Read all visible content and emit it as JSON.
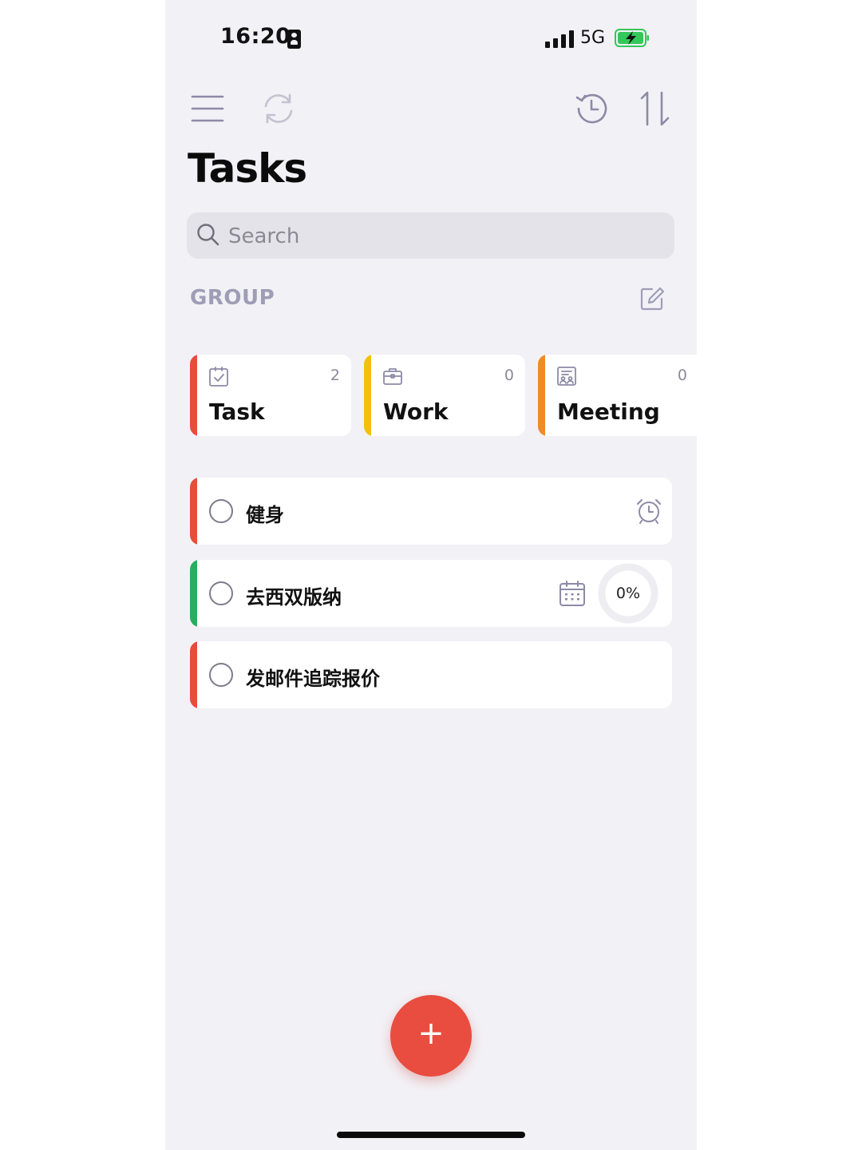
{
  "status_bar": {
    "time": "16:20",
    "network": "5G",
    "signal_bars": 4,
    "battery": "charging"
  },
  "toolbar": {
    "left_icons": [
      "menu-icon",
      "sync-icon"
    ],
    "right_icons": [
      "history-icon",
      "sort-icon"
    ]
  },
  "page_title": "Tasks",
  "search": {
    "placeholder": "Search",
    "value": ""
  },
  "group_section": {
    "label": "GROUP",
    "edit_icon": "edit-icon"
  },
  "groups": [
    {
      "name": "Task",
      "count": "2",
      "color": "#e84c3d",
      "icon": "checklist-icon"
    },
    {
      "name": "Work",
      "count": "0",
      "color": "#f2c10f",
      "icon": "briefcase-icon"
    },
    {
      "name": "Meeting",
      "count": "0",
      "color": "#ef8c26",
      "icon": "meeting-icon"
    }
  ],
  "tasks": [
    {
      "title": "健身",
      "color": "#e84c3d",
      "icon": "alarm-icon"
    },
    {
      "title": "去西双版纳",
      "color": "#27ae60",
      "icon": "calendar-icon",
      "progress": "0%"
    },
    {
      "title": "发邮件追踪报价",
      "color": "#e84c3d"
    }
  ],
  "fab": {
    "label": "+"
  },
  "colors": {
    "background": "#f2f1f6",
    "accent": "#e84d3f",
    "muted": "#9f9db6"
  }
}
